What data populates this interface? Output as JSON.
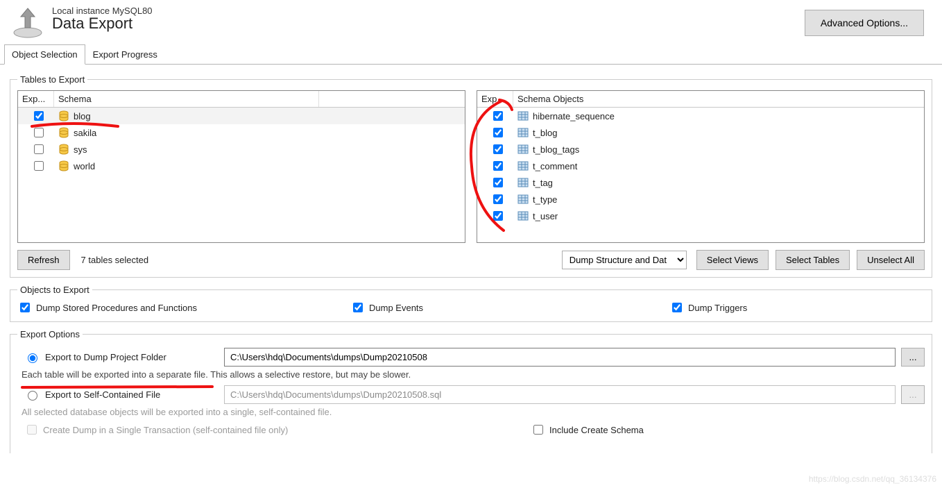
{
  "header": {
    "instance": "Local instance MySQL80",
    "title": "Data Export",
    "advanced_btn": "Advanced Options..."
  },
  "tabs": {
    "selection": "Object Selection",
    "progress": "Export Progress"
  },
  "tables_fieldset": {
    "legend": "Tables to Export",
    "left_headers": {
      "exp": "Exp...",
      "schema": "Schema"
    },
    "right_headers": {
      "exp": "Exp...",
      "schema": "Schema Objects"
    },
    "schemas": [
      {
        "name": "blog",
        "checked": true,
        "highlight": true
      },
      {
        "name": "sakila",
        "checked": false,
        "highlight": false
      },
      {
        "name": "sys",
        "checked": false,
        "highlight": false
      },
      {
        "name": "world",
        "checked": false,
        "highlight": false
      }
    ],
    "objects": [
      {
        "name": "hibernate_sequence",
        "checked": true
      },
      {
        "name": "t_blog",
        "checked": true
      },
      {
        "name": "t_blog_tags",
        "checked": true
      },
      {
        "name": "t_comment",
        "checked": true
      },
      {
        "name": "t_tag",
        "checked": true
      },
      {
        "name": "t_type",
        "checked": true
      },
      {
        "name": "t_user",
        "checked": true
      }
    ],
    "refresh_btn": "Refresh",
    "selected_text": "7 tables selected",
    "dump_mode": "Dump Structure and Dat",
    "select_views_btn": "Select Views",
    "select_tables_btn": "Select Tables",
    "unselect_all_btn": "Unselect All"
  },
  "objects_export": {
    "legend": "Objects to Export",
    "stored": "Dump Stored Procedures and Functions",
    "events": "Dump Events",
    "triggers": "Dump Triggers"
  },
  "export_options": {
    "legend": "Export Options",
    "folder_radio": "Export to Dump Project Folder",
    "folder_path": "C:\\Users\\hdq\\Documents\\dumps\\Dump20210508",
    "folder_hint": "Each table will be exported into a separate file. This allows a selective restore, but may be slower.",
    "file_radio": "Export to Self-Contained File",
    "file_path": "C:\\Users\\hdq\\Documents\\dumps\\Dump20210508.sql",
    "file_hint": "All selected database objects will be exported into a single, self-contained file.",
    "single_tx": "Create Dump in a Single Transaction (self-contained file only)",
    "include_schema": "Include Create Schema",
    "browse": "..."
  },
  "watermark": "https://blog.csdn.net/qq_36134376"
}
